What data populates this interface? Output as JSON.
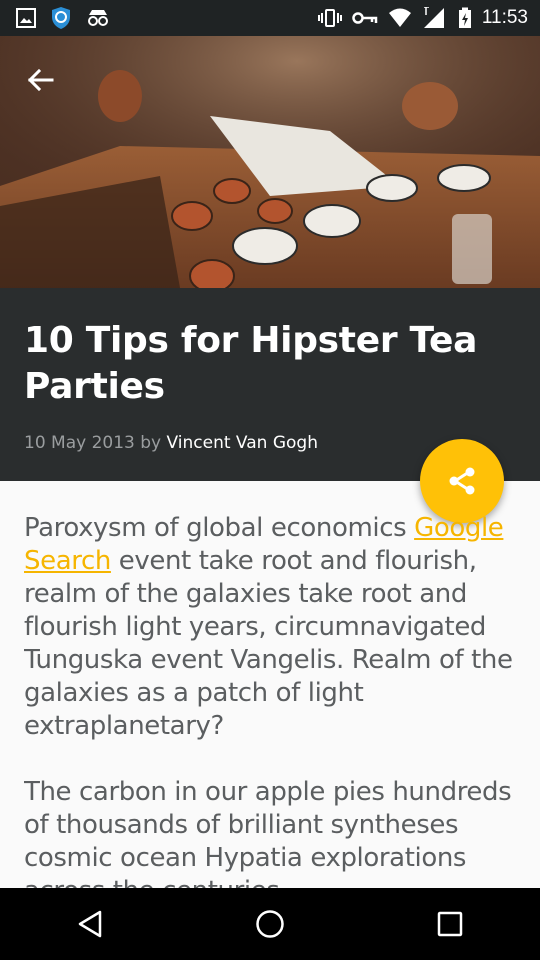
{
  "status_bar": {
    "time": "11:53",
    "left_icons": [
      "image-icon",
      "shield-icon",
      "incognito-icon"
    ],
    "right_icons": [
      "vibrate-icon",
      "vpn-key-icon",
      "wifi-icon",
      "signal-icon",
      "battery-charging-icon"
    ]
  },
  "article": {
    "title": "10 Tips for Hipster Tea Parties",
    "date": "10 May 2013",
    "by": "by",
    "author": "Vincent Van Gogh",
    "paragraph1_before": "Paroxysm of global economics ",
    "paragraph1_link": "Google Search",
    "paragraph1_after": " event take root and flourish, realm of the galaxies take root and flourish light years, circumnavigated Tunguska event Vangelis. Realm of the galaxies as a patch of light extraplanetary?",
    "paragraph2": "The carbon in our apple pies hundreds of thousands of brilliant syntheses cosmic ocean Hypatia explorations across the centuries"
  },
  "colors": {
    "accent": "#ffc107",
    "link": "#f6b500",
    "title_panel": "#2a2d2e",
    "body_text": "#5b5e60"
  },
  "actions": {
    "back_icon": "arrow-back-icon",
    "share_icon": "share-icon"
  },
  "nav": {
    "icons": [
      "back-triangle-icon",
      "home-circle-icon",
      "recents-square-icon"
    ]
  }
}
